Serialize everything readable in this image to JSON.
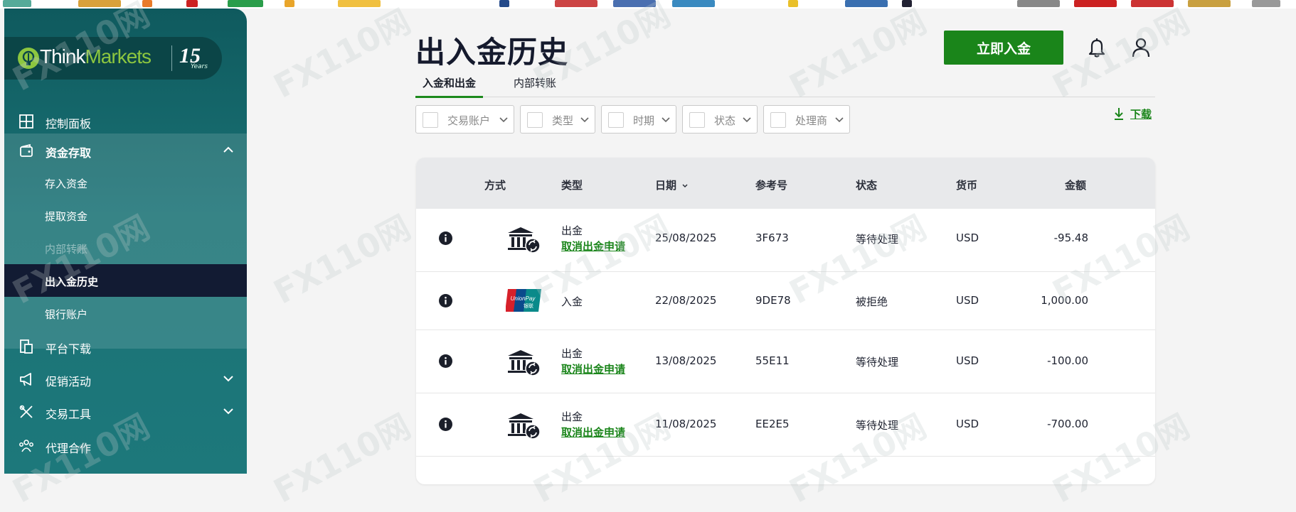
{
  "sidebar": {
    "logo_think": "Think",
    "logo_markets": "Markets",
    "logo_badge": "15",
    "logo_years": "Years",
    "items": [
      {
        "label": "控制面板",
        "icon": "dashboard-icon"
      },
      {
        "label": "资金存取",
        "icon": "wallet-icon",
        "expanded": true
      },
      {
        "label": "平台下载",
        "icon": "download-platform-icon"
      },
      {
        "label": "促销活动",
        "icon": "megaphone-icon"
      },
      {
        "label": "交易工具",
        "icon": "tools-icon"
      },
      {
        "label": "代理合作",
        "icon": "partners-icon"
      }
    ],
    "subitems": [
      {
        "label": "存入资金"
      },
      {
        "label": "提取资金"
      },
      {
        "label": "内部转账"
      },
      {
        "label": "出入金历史",
        "active": true
      },
      {
        "label": "银行账户"
      }
    ]
  },
  "header": {
    "title": "出入金历史",
    "deposit_button": "立即入金"
  },
  "tabs": [
    {
      "label": "入金和出金",
      "active": true
    },
    {
      "label": "内部转账",
      "active": false
    }
  ],
  "filters": [
    {
      "label": "交易账户"
    },
    {
      "label": "类型"
    },
    {
      "label": "时期"
    },
    {
      "label": "状态"
    },
    {
      "label": "处理商"
    }
  ],
  "download_label": "下载",
  "table": {
    "columns": [
      "方式",
      "类型",
      "日期",
      "参考号",
      "状态",
      "货币",
      "金额"
    ],
    "rows": [
      {
        "method": "bank-transfer-icon",
        "type": "出金",
        "action": "取消出金申请",
        "date": "25/08/2025",
        "ref": "3F673",
        "status": "等待处理",
        "currency": "USD",
        "amount": "-95.48"
      },
      {
        "method": "unionpay-icon",
        "type": "入金",
        "action": "",
        "date": "22/08/2025",
        "ref": "9DE78",
        "status": "被拒绝",
        "currency": "USD",
        "amount": "1,000.00"
      },
      {
        "method": "bank-transfer-icon",
        "type": "出金",
        "action": "取消出金申请",
        "date": "13/08/2025",
        "ref": "55E11",
        "status": "等待处理",
        "currency": "USD",
        "amount": "-100.00"
      },
      {
        "method": "bank-transfer-icon",
        "type": "出金",
        "action": "取消出金申请",
        "date": "11/08/2025",
        "ref": "EE2E5",
        "status": "等待处理",
        "currency": "USD",
        "amount": "-700.00"
      }
    ]
  },
  "colors": {
    "accent": "#1a851a",
    "sidebar": "#1a7275",
    "active_item": "#121b33"
  },
  "watermark": "FX110网"
}
